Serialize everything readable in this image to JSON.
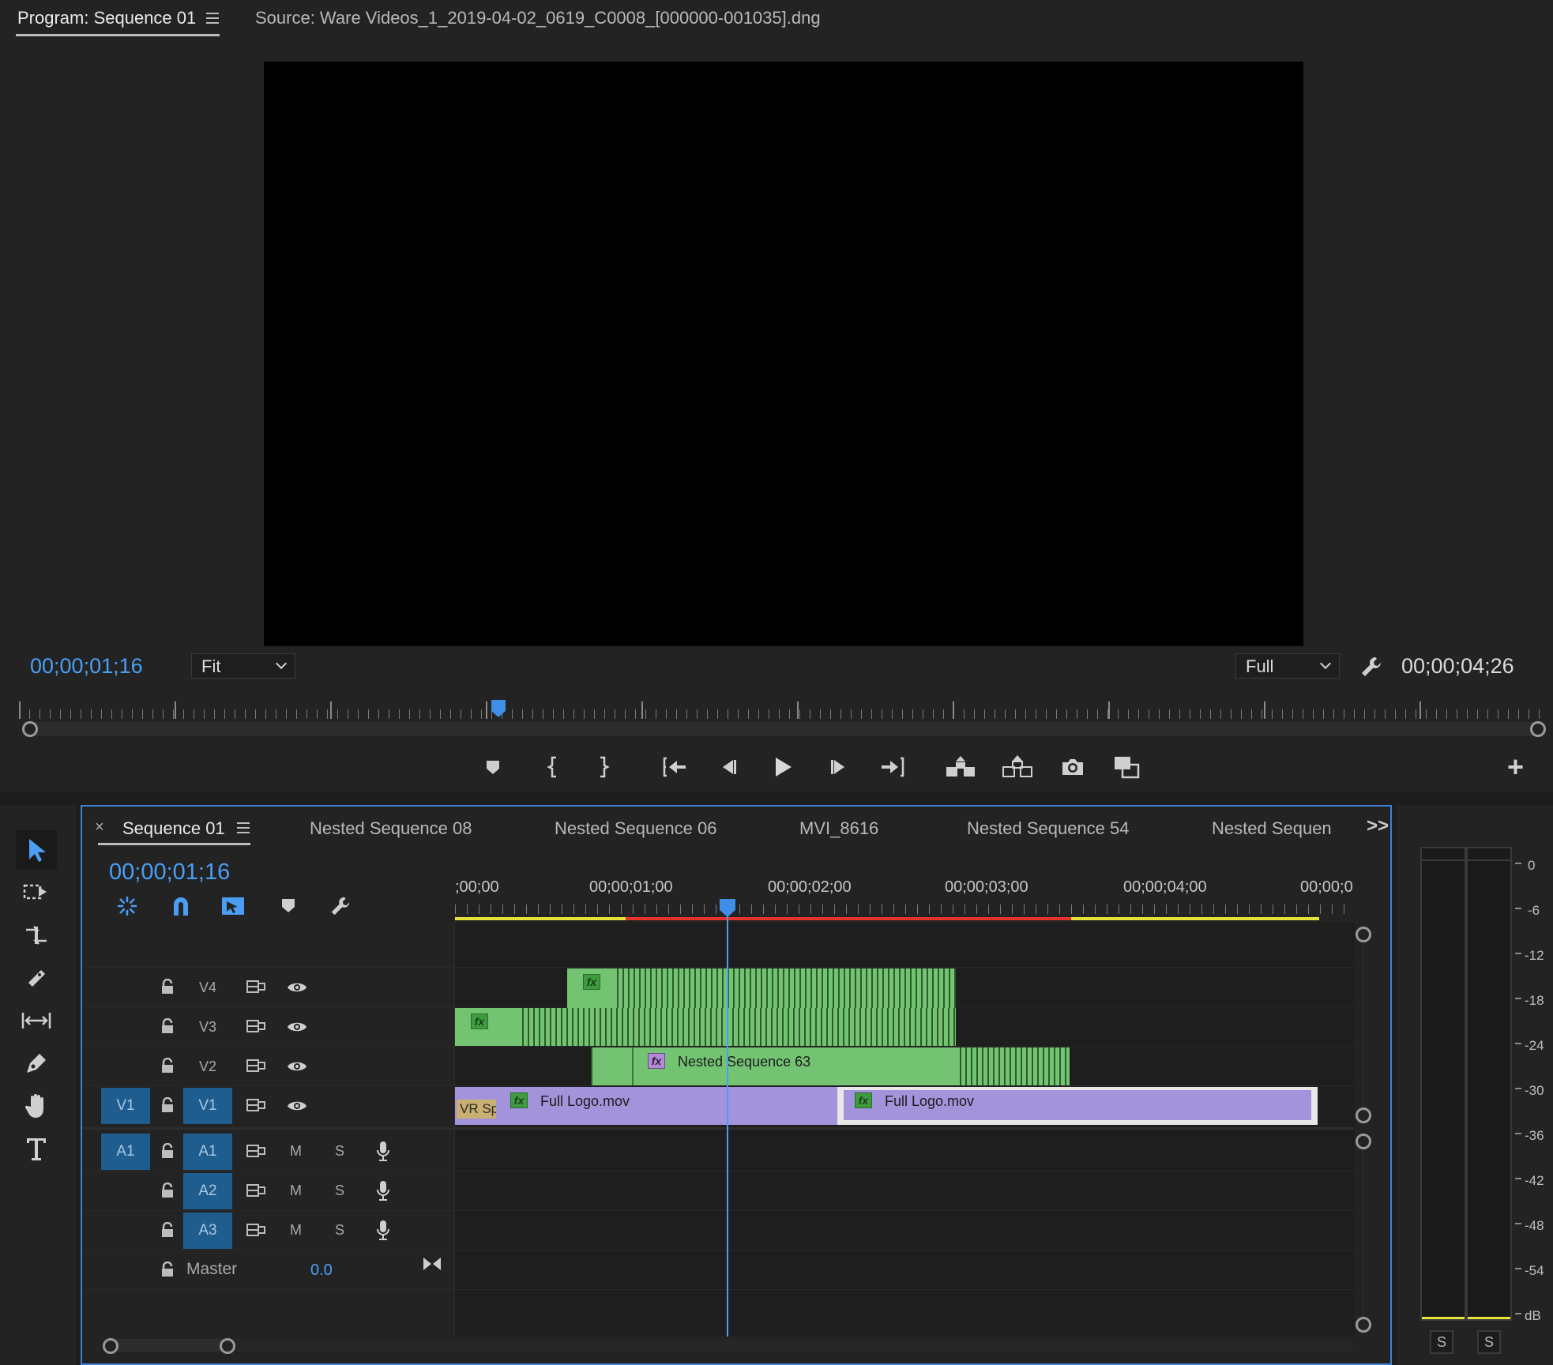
{
  "program_tab": {
    "label": "Program: Sequence 01"
  },
  "source_tab": {
    "label": "Source: Ware Videos_1_2019-04-02_0619_C0008_[000000-001035].dng"
  },
  "monitor": {
    "current_timecode": "00;00;01;16",
    "fit_select": "Fit",
    "resolution_select": "Full",
    "duration_timecode": "00;00;04;26",
    "playhead_position": 0.31
  },
  "transport": {
    "buttons": [
      "add-marker",
      "mark-in",
      "mark-out",
      "go-to-in",
      "step-back",
      "play",
      "step-forward",
      "go-to-out",
      "lift",
      "extract",
      "export-frame",
      "comparison-view"
    ],
    "add_label": "+"
  },
  "timeline": {
    "tabs": [
      {
        "label": "Sequence 01",
        "active": true
      },
      {
        "label": "Nested Sequence 08"
      },
      {
        "label": "Nested Sequence 06"
      },
      {
        "label": "MVI_8616"
      },
      {
        "label": "Nested Sequence 54"
      },
      {
        "label": "Nested Sequen"
      }
    ],
    "close_label": "×",
    "overflow_label": ">>",
    "current_timecode": "00;00;01;16",
    "ruler": [
      ";00;00",
      "00;00;01;00",
      "00;00;02;00",
      "00;00;03;00",
      "00;00;04;00",
      "00;00;0"
    ],
    "video_tracks": [
      {
        "name": "V4"
      },
      {
        "name": "V3"
      },
      {
        "name": "V2"
      },
      {
        "name": "V1",
        "source_patch": "V1"
      }
    ],
    "audio_tracks": [
      {
        "name": "A1",
        "source_patch": "A1",
        "mute": "M",
        "solo": "S"
      },
      {
        "name": "A2",
        "mute": "M",
        "solo": "S"
      },
      {
        "name": "A3",
        "mute": "M",
        "solo": "S"
      }
    ],
    "master": {
      "label": "Master",
      "value": "0.0"
    },
    "clips": {
      "v4": {
        "fx": "fx"
      },
      "v3": {
        "fx": "fx"
      },
      "v2": {
        "fx": "fx",
        "name": "Nested Sequence 63"
      },
      "v1a": {
        "fx": "fx",
        "name": "Full Logo.mov",
        "prefix": "VR Sp"
      },
      "v1b": {
        "fx": "fx",
        "name": "Full Logo.mov"
      }
    }
  },
  "tools": [
    "selection",
    "track-select-forward",
    "ripple-edit",
    "razor",
    "slip",
    "pen",
    "hand",
    "type"
  ],
  "audio_meter": {
    "scale": [
      "0",
      "-6",
      "-12",
      "-18",
      "-24",
      "-30",
      "-36",
      "-42",
      "-48",
      "-54",
      "dB"
    ],
    "solo_labels": [
      "S",
      "S"
    ]
  },
  "colors": {
    "accent": "#4a9ff5",
    "video_clip": "#73c373",
    "audio_clip": "#a293da",
    "render_bar_yellow": "#e6e23c",
    "render_bar_red": "#e8322d"
  }
}
